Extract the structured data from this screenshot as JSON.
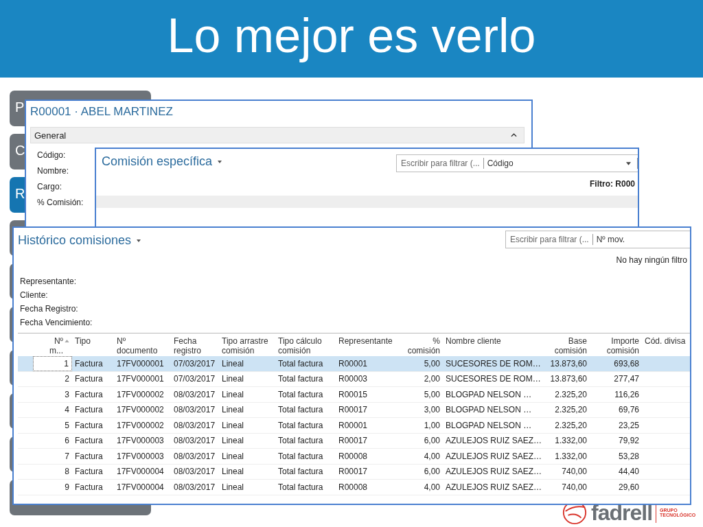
{
  "slide": {
    "title": "Lo mejor es verlo"
  },
  "side_tabs": [
    {
      "label": "P",
      "selected": false
    },
    {
      "label": "C",
      "selected": false
    },
    {
      "label": "R",
      "selected": true
    }
  ],
  "representative_card": {
    "title": "R00001 · ABEL MARTINEZ",
    "section": {
      "label": "General",
      "expanded": true
    },
    "fields": [
      "Código:",
      "Nombre:",
      "Cargo:",
      "% Comisión:"
    ]
  },
  "specific_commission": {
    "title": "Comisión específica",
    "filter": {
      "placeholder": "Escribir para filtrar (...",
      "field": "Código"
    },
    "filter_status": "Filtro: R000"
  },
  "history": {
    "title": "Histórico comisiones",
    "filter": {
      "placeholder": "Escribir para filtrar (...",
      "field": "Nº mov."
    },
    "filter_status": "No hay ningún filtro",
    "filter_labels": [
      "Representante:",
      "Cliente:",
      "Fecha Registro:",
      "Fecha Vencimiento:"
    ],
    "table": {
      "columns": [
        {
          "lines": [
            "Nº",
            "m..."
          ],
          "numeric": true,
          "sorted": true
        },
        {
          "lines": [
            "Tipo"
          ],
          "numeric": false,
          "sorted": false
        },
        {
          "lines": [
            "Nº",
            "documento"
          ],
          "numeric": false,
          "sorted": false
        },
        {
          "lines": [
            "Fecha",
            "registro"
          ],
          "numeric": false,
          "sorted": false
        },
        {
          "lines": [
            "Tipo arrastre",
            "comisión"
          ],
          "numeric": false,
          "sorted": false
        },
        {
          "lines": [
            "Tipo cálculo",
            "comisión"
          ],
          "numeric": false,
          "sorted": false
        },
        {
          "lines": [
            "Representante"
          ],
          "numeric": false,
          "sorted": false
        },
        {
          "lines": [
            "%",
            "comisión"
          ],
          "numeric": true,
          "sorted": false
        },
        {
          "lines": [
            "Nombre cliente"
          ],
          "numeric": false,
          "sorted": false
        },
        {
          "lines": [
            "Base",
            "comisión"
          ],
          "numeric": true,
          "sorted": false
        },
        {
          "lines": [
            "Importe",
            "comisión"
          ],
          "numeric": true,
          "sorted": false
        },
        {
          "lines": [
            "Cód. divisa"
          ],
          "numeric": false,
          "sorted": false
        }
      ],
      "rows": [
        {
          "selected": true,
          "cells": [
            "1",
            "Factura",
            "17FV000001",
            "07/03/2017",
            "Lineal",
            "Total factura",
            "R00001",
            "5,00",
            "SUCESORES DE ROM…",
            "13.873,60",
            "693,68"
          ]
        },
        {
          "selected": false,
          "cells": [
            "2",
            "Factura",
            "17FV000001",
            "07/03/2017",
            "Lineal",
            "Total factura",
            "R00003",
            "2,00",
            "SUCESORES DE ROM…",
            "13.873,60",
            "277,47"
          ]
        },
        {
          "selected": false,
          "cells": [
            "3",
            "Factura",
            "17FV000002",
            "08/03/2017",
            "Lineal",
            "Total factura",
            "R00015",
            "5,00",
            "BLOGPAD NELSON …",
            "2.325,20",
            "116,26"
          ]
        },
        {
          "selected": false,
          "cells": [
            "4",
            "Factura",
            "17FV000002",
            "08/03/2017",
            "Lineal",
            "Total factura",
            "R00017",
            "3,00",
            "BLOGPAD NELSON …",
            "2.325,20",
            "69,76"
          ]
        },
        {
          "selected": false,
          "cells": [
            "5",
            "Factura",
            "17FV000002",
            "08/03/2017",
            "Lineal",
            "Total factura",
            "R00001",
            "1,00",
            "BLOGPAD NELSON …",
            "2.325,20",
            "23,25"
          ]
        },
        {
          "selected": false,
          "cells": [
            "6",
            "Factura",
            "17FV000003",
            "08/03/2017",
            "Lineal",
            "Total factura",
            "R00017",
            "6,00",
            "AZULEJOS RUIZ SAEZ…",
            "1.332,00",
            "79,92"
          ]
        },
        {
          "selected": false,
          "cells": [
            "7",
            "Factura",
            "17FV000003",
            "08/03/2017",
            "Lineal",
            "Total factura",
            "R00008",
            "4,00",
            "AZULEJOS RUIZ SAEZ…",
            "1.332,00",
            "53,28"
          ]
        },
        {
          "selected": false,
          "cells": [
            "8",
            "Factura",
            "17FV000004",
            "08/03/2017",
            "Lineal",
            "Total factura",
            "R00017",
            "6,00",
            "AZULEJOS RUIZ SAEZ…",
            "740,00",
            "44,40"
          ]
        },
        {
          "selected": false,
          "cells": [
            "9",
            "Factura",
            "17FV000004",
            "08/03/2017",
            "Lineal",
            "Total factura",
            "R00008",
            "4,00",
            "AZULEJOS RUIZ SAEZ…",
            "740,00",
            "29,60"
          ]
        }
      ]
    }
  },
  "logo": {
    "name": "fadrell",
    "tagline": [
      "GRUPO",
      "TECNOLÓGICO"
    ]
  }
}
